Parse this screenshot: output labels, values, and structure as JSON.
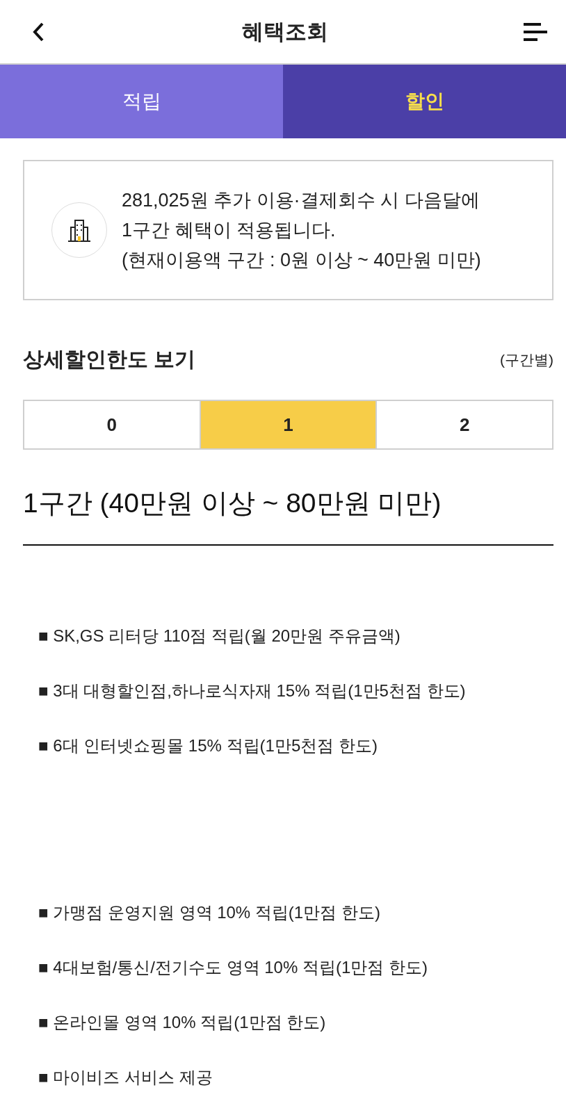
{
  "header": {
    "title": "혜택조회"
  },
  "tabs": [
    {
      "label": "적립",
      "selected": false
    },
    {
      "label": "할인",
      "selected": true
    }
  ],
  "notice": {
    "lines": [
      "281,025원 추가 이용·결제회수 시 다음달에",
      "1구간 혜택이 적용됩니다.",
      "(현재이용액 구간 : 0원 이상 ~ 40만원 미만)"
    ]
  },
  "detail": {
    "title": "상세할인한도 보기",
    "note": "(구간별)"
  },
  "bands": [
    {
      "label": "0",
      "selected": false
    },
    {
      "label": "1",
      "selected": true
    },
    {
      "label": "2",
      "selected": false
    }
  ],
  "band_title": "1구간 (40만원 이상 ~ 80만원 미만)",
  "benefit_groups": [
    {
      "items": [
        "■ SK,GS 리터당 110점 적립(월 20만원 주유금액)",
        "■ 3대 대형할인점,하나로식자재 15% 적립(1만5천점 한도)",
        "■ 6대 인터넷쇼핑몰 15% 적립(1만5천점 한도)"
      ]
    },
    {
      "items": [
        "■ 가맹점 운영지원 영역 10% 적립(1만점 한도)",
        "■ 4대보험/통신/전기수도 영역 10% 적립(1만점 한도)",
        "■ 온라인몰 영역 10% 적립(1만점 한도)",
        "■ 마이비즈 서비스 제공"
      ]
    }
  ]
}
